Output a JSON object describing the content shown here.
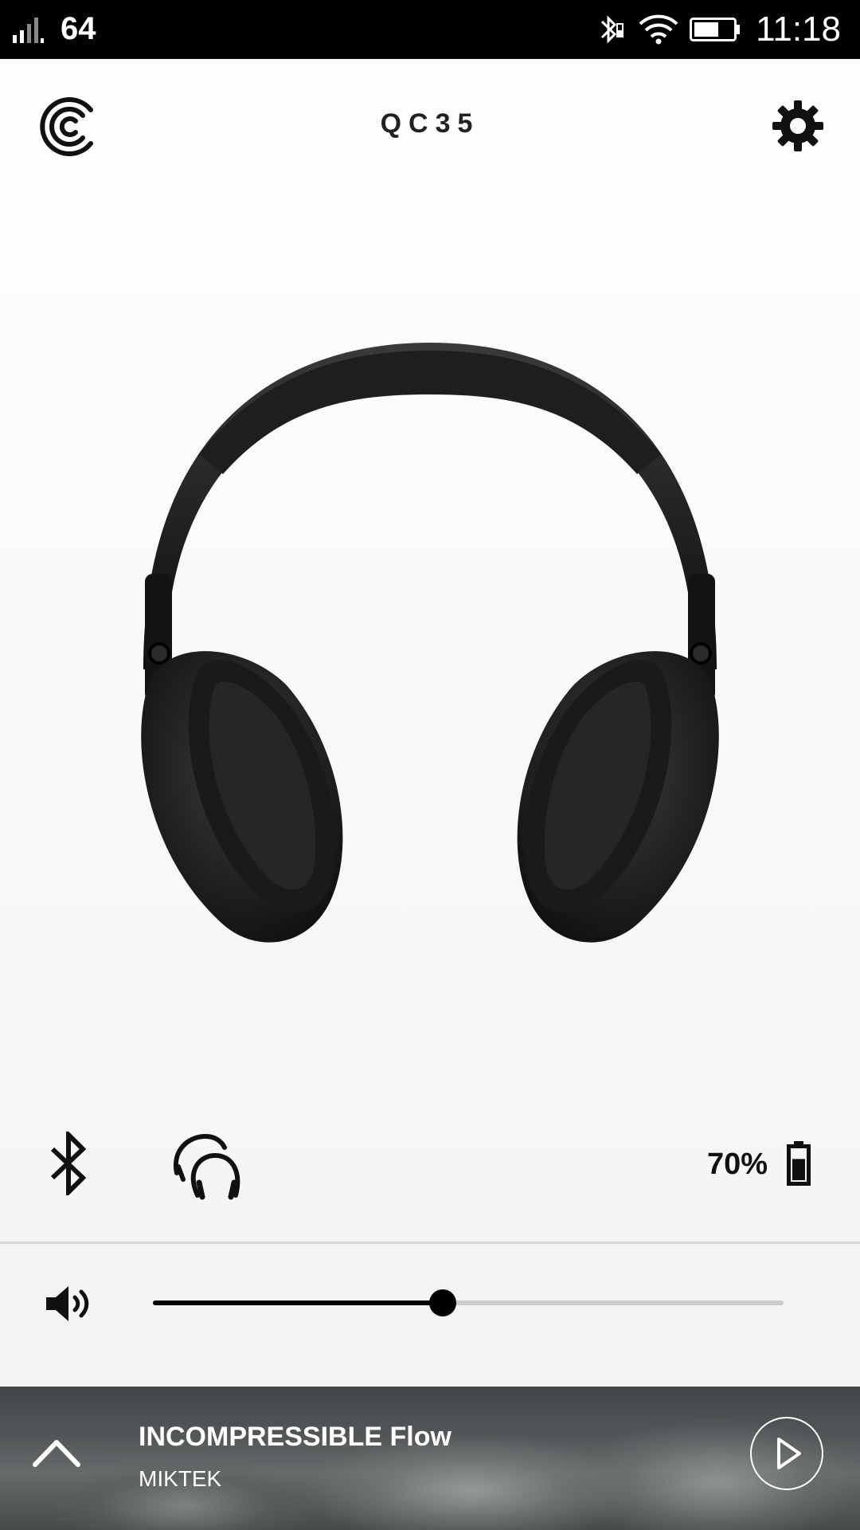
{
  "status_bar": {
    "carrier": "64",
    "time": "11:18",
    "icons": [
      "signal-icon",
      "bluetooth-icon",
      "wifi-icon",
      "battery-icon"
    ]
  },
  "header": {
    "title": "QC35",
    "logo_icon": "bose-connect-logo-icon",
    "settings_icon": "gear-icon"
  },
  "device": {
    "image": "headphones-image",
    "battery_percent": "70%",
    "battery_level": 0.7
  },
  "volume": {
    "level": 0.46
  },
  "now_playing": {
    "title": "INCOMPRESSIBLE Flow",
    "artist": "MIKTEK",
    "expand_icon": "chevron-up-icon",
    "play_icon": "play-icon"
  }
}
